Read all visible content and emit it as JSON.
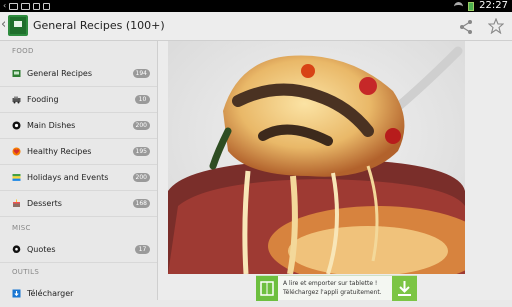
{
  "status_bar": {
    "time": "22:27"
  },
  "action_bar": {
    "title": "General Recipes (100+)"
  },
  "sidebar": {
    "sections": [
      {
        "header": "FOOD",
        "items": [
          {
            "label": "General Recipes",
            "count": "194",
            "icon": "tv-icon"
          },
          {
            "label": "Fooding",
            "count": "10",
            "icon": "car-icon"
          },
          {
            "label": "Main Dishes",
            "count": "200",
            "icon": "globe-icon"
          },
          {
            "label": "Healthy Recipes",
            "count": "195",
            "icon": "heart-icon"
          },
          {
            "label": "Holidays and Events",
            "count": "200",
            "icon": "flag-icon"
          },
          {
            "label": "Desserts",
            "count": "168",
            "icon": "cake-icon"
          }
        ]
      },
      {
        "header": "MISC",
        "items": [
          {
            "label": "Quotes",
            "count": "17",
            "icon": "chat-icon"
          }
        ]
      },
      {
        "header": "OUTILS",
        "items": [
          {
            "label": "Télécharger",
            "count": "",
            "icon": "download-icon"
          }
        ]
      }
    ]
  },
  "banner": {
    "line1": "A lire et emporter sur tablette !",
    "line2": "Téléchargez l'appli gratuitement."
  },
  "colors": {
    "accent_green": "#1f6f2c",
    "badge_grey": "#9a9a9a"
  }
}
